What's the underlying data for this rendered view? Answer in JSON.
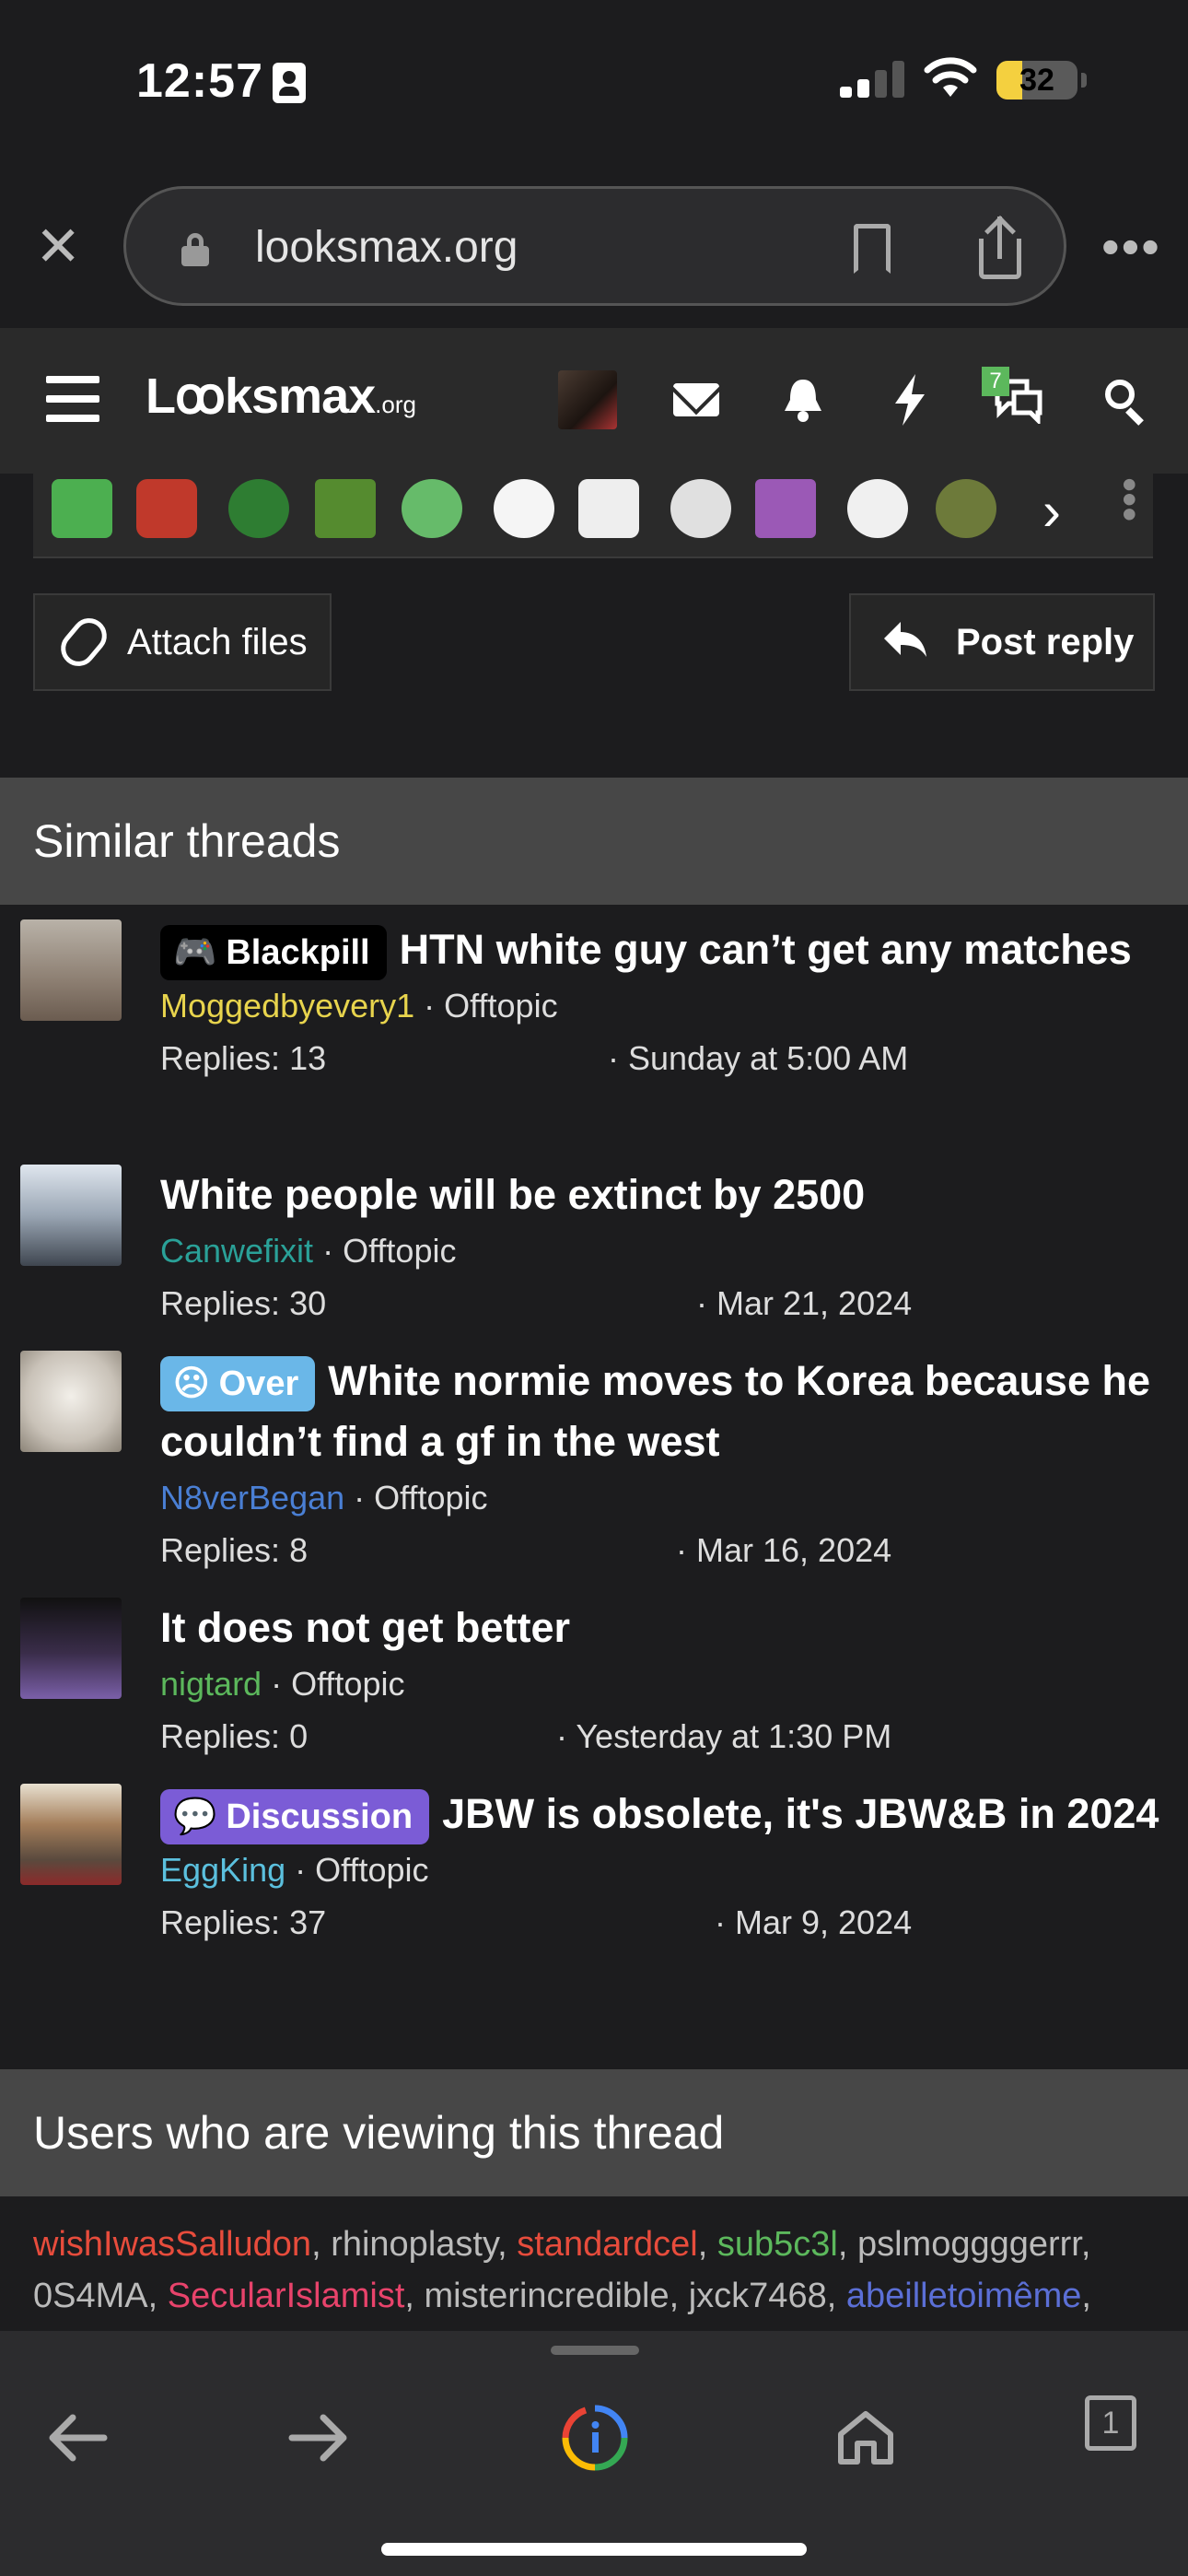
{
  "status_bar": {
    "time": "12:57",
    "battery": "32",
    "battery_level": 0.32
  },
  "browser": {
    "url": "looksmax.org"
  },
  "site": {
    "logo": "Lꝏksmax",
    "logo_suffix": ".org",
    "chat_badge": "7"
  },
  "editor": {
    "attach_label": "Attach files",
    "reply_label": "Post reply"
  },
  "similar": {
    "heading": "Similar threads",
    "threads": [
      {
        "tag": "Blackpill",
        "tag_color": "#000000",
        "title": "HTN white guy can’t get any matches",
        "user": "Moggedbyevery1",
        "user_color": "#e8d44d",
        "forum": "Offtopic",
        "replies": "Replies: 13",
        "date": "Sunday at 5:00 AM"
      },
      {
        "tag": "",
        "title": "White people will be extinct by 2500",
        "user": "Canwefixit",
        "user_color": "#2aa198",
        "forum": "Offtopic",
        "replies": "Replies: 30",
        "date": "Mar 21, 2024"
      },
      {
        "tag": "Over",
        "tag_color": "#6ab7e8",
        "title": "White normie moves to Korea because he couldn’t find a gf in the west",
        "user": "N8verBegan",
        "user_color": "#4a7fd4",
        "forum": "Offtopic",
        "replies": "Replies: 8",
        "date": "Mar 16, 2024"
      },
      {
        "tag": "",
        "title": "It does not get better",
        "user": "nigtard",
        "user_color": "#5cb85c",
        "forum": "Offtopic",
        "replies": "Replies: 0",
        "date": "Yesterday at 1:30 PM"
      },
      {
        "tag": "Discussion",
        "tag_color": "#7b5cd6",
        "title": "JBW is obsolete, it's JBW&B in 2024",
        "user": "EggKing",
        "user_color": "#5bc0de",
        "forum": "Offtopic",
        "replies": "Replies: 37",
        "date": "Mar 9, 2024"
      }
    ]
  },
  "viewing": {
    "heading": "Users who are viewing this thread",
    "users": [
      {
        "name": "wishIwasSalludon",
        "color": "#e74c3c"
      },
      {
        "name": "rhinoplasty",
        "color": "#bbbbbb"
      },
      {
        "name": "standardcel",
        "color": "#e74c3c"
      },
      {
        "name": "sub5c3l",
        "color": "#5cb85c"
      },
      {
        "name": "pslmoggggerrr",
        "color": "#bbbbbb"
      },
      {
        "name": "0S4MA",
        "color": "#bbbbbb"
      },
      {
        "name": "SecularIslamist",
        "color": "#e8436b"
      },
      {
        "name": "misterincredible",
        "color": "#bbbbbb"
      },
      {
        "name": "jxck7468",
        "color": "#bbbbbb"
      },
      {
        "name": "abeilletoimême",
        "color": "#5b6fd6"
      }
    ]
  },
  "toolbar": {
    "tab_count": "1"
  }
}
